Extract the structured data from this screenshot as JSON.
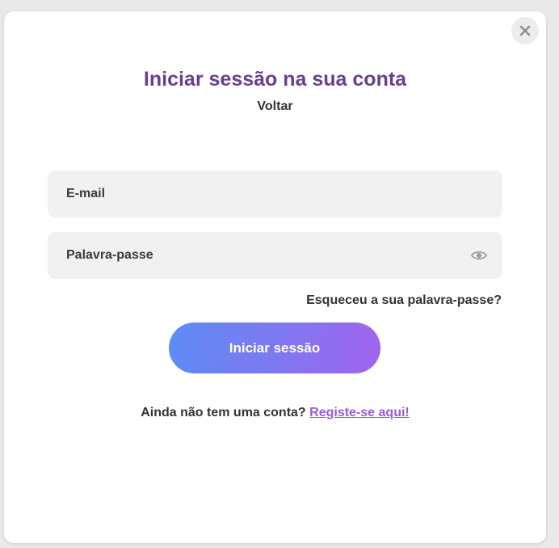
{
  "modal": {
    "title": "Iniciar sessão na sua conta",
    "back_label": "Voltar",
    "close_icon": "close-icon"
  },
  "form": {
    "email": {
      "placeholder": "E-mail",
      "value": ""
    },
    "password": {
      "placeholder": "Palavra-passe",
      "value": "",
      "toggle_icon": "eye-icon"
    },
    "forgot_password_label": "Esqueceu a sua palavra-passe?",
    "submit_label": "Iniciar sessão"
  },
  "signup": {
    "prompt": "Ainda não tem uma conta?",
    "link_label": "Registe-se aqui!"
  },
  "colors": {
    "title": "#6a3f8f",
    "text": "#333333",
    "link": "#9a5be0",
    "button_gradient_start": "#5c8df5",
    "button_gradient_end": "#a163ee",
    "field_background": "#f1f1f1"
  }
}
